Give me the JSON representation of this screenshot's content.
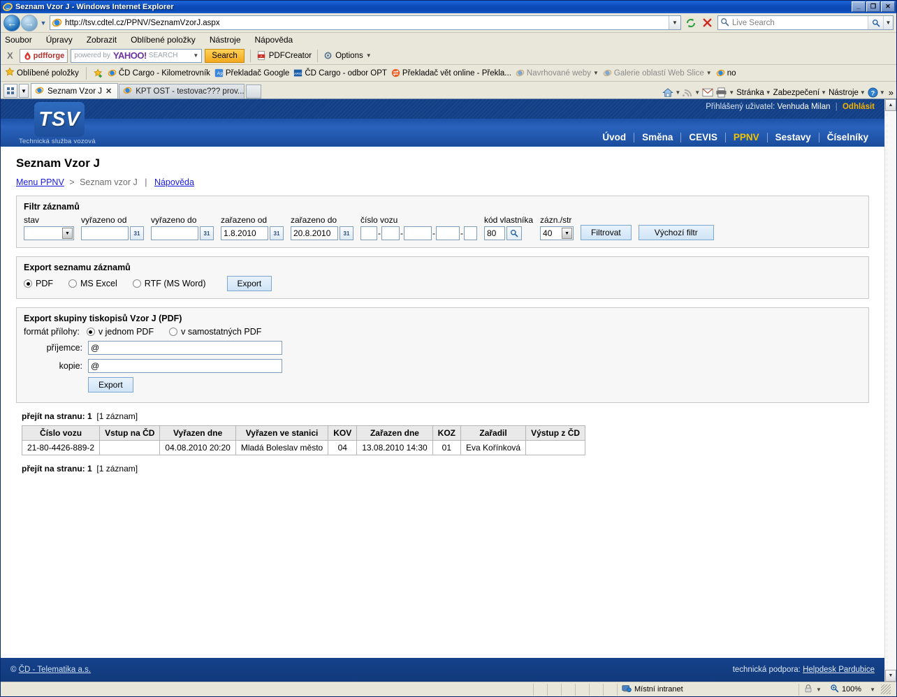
{
  "window": {
    "title": "Seznam Vzor J - Windows Internet Explorer",
    "minimize": "_",
    "restore": "❐",
    "close": "✕"
  },
  "address": {
    "url": "http://tsv.cdtel.cz/PPNV/SeznamVzorJ.aspx",
    "refresh_icon": "refresh-icon",
    "stop_icon": "stop-icon",
    "search_placeholder": "Live Search"
  },
  "menubar": {
    "items": [
      "Soubor",
      "Úpravy",
      "Zobrazit",
      "Oblíbené položky",
      "Nástroje",
      "Nápověda"
    ]
  },
  "pdf_toolbar": {
    "close_label": "X",
    "brand": "pdfforge",
    "search_box_text": "powered by",
    "yahoo": "YAHOO!",
    "yahoo_search": "SEARCH",
    "search_button": "Search",
    "pdfcreator": "PDFCreator",
    "options": "Options"
  },
  "favorites_bar": {
    "label": "Oblíbené položky",
    "items": [
      "ČD Cargo - Kilometrovník",
      "Překladač Google",
      "ČD Cargo - odbor OPT",
      "Překladač vět online - Překla...",
      "Navrhované weby",
      "Galerie oblastí Web Slice",
      "no"
    ]
  },
  "tabs": [
    {
      "label": "Seznam Vzor J",
      "active": true
    },
    {
      "label": "KPT OST - testovac??? prov...",
      "active": false
    }
  ],
  "command_bar": {
    "items": [
      "Stránka",
      "Zabezpečení",
      "Nástroje"
    ],
    "overflow": "»"
  },
  "app_header": {
    "logged_in_label": "Přihlášený uživatel:",
    "user_name": "Venhuda Milan",
    "logout": "Odhlásit",
    "logo_text": "TSV",
    "logo_subtitle": "Technická služba vozová",
    "nav": [
      {
        "label": "Úvod",
        "active": false
      },
      {
        "label": "Směna",
        "active": false
      },
      {
        "label": "CEVIS",
        "active": false
      },
      {
        "label": "PPNV",
        "active": true
      },
      {
        "label": "Sestavy",
        "active": false
      },
      {
        "label": "Číselníky",
        "active": false
      }
    ]
  },
  "page": {
    "title": "Seznam Vzor J",
    "breadcrumb": {
      "root": "Menu PPNV",
      "separator": ">",
      "current": "Seznam vzor J",
      "pipe": "|",
      "help": "Nápověda"
    }
  },
  "filter_panel": {
    "heading": "Filtr záznamů",
    "fields": [
      {
        "label": "stav",
        "value": "",
        "type": "select"
      },
      {
        "label": "vyřazeno od",
        "value": "",
        "type": "date"
      },
      {
        "label": "vyřazeno do",
        "value": "",
        "type": "date"
      },
      {
        "label": "zařazeno od",
        "value": "1.8.2010",
        "type": "date"
      },
      {
        "label": "zařazeno do",
        "value": "20.8.2010",
        "type": "date"
      }
    ],
    "cislo_vozu": {
      "label": "číslo vozu",
      "parts": [
        "",
        "",
        "",
        "",
        ""
      ]
    },
    "kod_vlastnika": {
      "label": "kód vlastníka",
      "value": "80"
    },
    "zazn_str": {
      "label": "zázn./str",
      "value": "40"
    },
    "filter_button": "Filtrovat",
    "default_filter_button": "Výchozí filtr",
    "calendar_icon": "31"
  },
  "export_list": {
    "heading": "Export seznamu záznamů",
    "options": [
      {
        "label": "PDF",
        "selected": true
      },
      {
        "label": "MS Excel",
        "selected": false
      },
      {
        "label": "RTF (MS Word)",
        "selected": false
      }
    ],
    "button": "Export"
  },
  "export_group": {
    "heading": "Export skupiny tiskopisů Vzor J (PDF)",
    "format_label": "formát přílohy:",
    "format_options": [
      {
        "label": "v jednom PDF",
        "selected": true
      },
      {
        "label": "v samostatných PDF",
        "selected": false
      }
    ],
    "recipient_label": "příjemce:",
    "recipient_value": "@",
    "copy_label": "kopie:",
    "copy_value": "@",
    "button": "Export"
  },
  "pager": {
    "label": "přejít na stranu:",
    "page": "1",
    "count": "[1 záznam]"
  },
  "table": {
    "columns": [
      "Číslo vozu",
      "Vstup na ČD",
      "Vyřazen dne",
      "Vyřazen ve stanici",
      "KOV",
      "Zařazen dne",
      "KOZ",
      "Zařadil",
      "Výstup z ČD"
    ],
    "rows": [
      {
        "cislo_vozu": "21-80-4426-889-2",
        "vstup_na_cd": "",
        "vyrazen_dne": "04.08.2010 20:20",
        "vyrazen_ve_stanici": "Mladá Boleslav město",
        "kov": "04",
        "zarazen_dne": "13.08.2010 14:30",
        "koz": "01",
        "zaradil": "Eva Kořínková",
        "vystup_z_cd": ""
      }
    ]
  },
  "app_footer": {
    "copyright_symbol": "©",
    "copyright_link": "ČD - Telematika a.s.",
    "support_label": "technická podpora:",
    "support_link": "Helpdesk Pardubice"
  },
  "statusbar": {
    "zone": "Místní intranet",
    "zoom": "100%"
  }
}
